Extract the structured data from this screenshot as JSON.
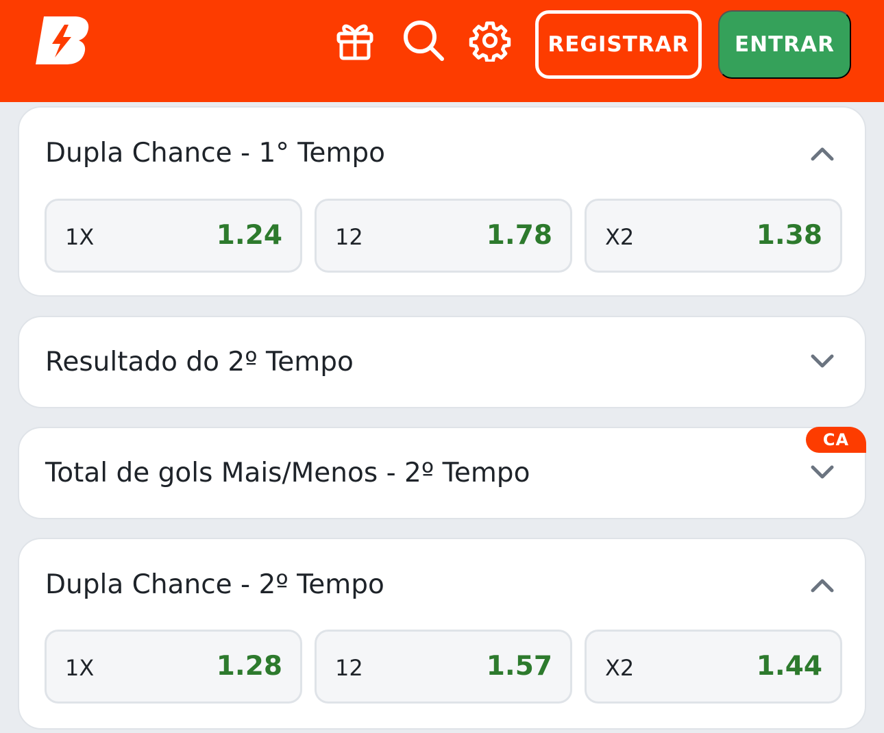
{
  "header": {
    "icons": [
      "gift-icon",
      "search-icon",
      "gear-icon"
    ],
    "register_label": "REGISTRAR",
    "login_label": "ENTRAR"
  },
  "markets": [
    {
      "title": "Dupla Chance - 1° Tempo",
      "expanded": true,
      "odds": [
        {
          "label": "1X",
          "value": "1.24"
        },
        {
          "label": "12",
          "value": "1.78"
        },
        {
          "label": "X2",
          "value": "1.38"
        }
      ]
    },
    {
      "title": "Resultado do 2º Tempo",
      "expanded": false
    },
    {
      "title": "Total de gols Mais/Menos - 2º Tempo",
      "expanded": false,
      "badge": "CA"
    },
    {
      "title": "Dupla Chance - 2º Tempo",
      "expanded": true,
      "odds": [
        {
          "label": "1X",
          "value": "1.28"
        },
        {
          "label": "12",
          "value": "1.57"
        },
        {
          "label": "X2",
          "value": "1.44"
        }
      ]
    }
  ],
  "colors": {
    "brand": "#fd3c00",
    "login": "#35a15a",
    "odd_value": "#2d7a2d"
  }
}
